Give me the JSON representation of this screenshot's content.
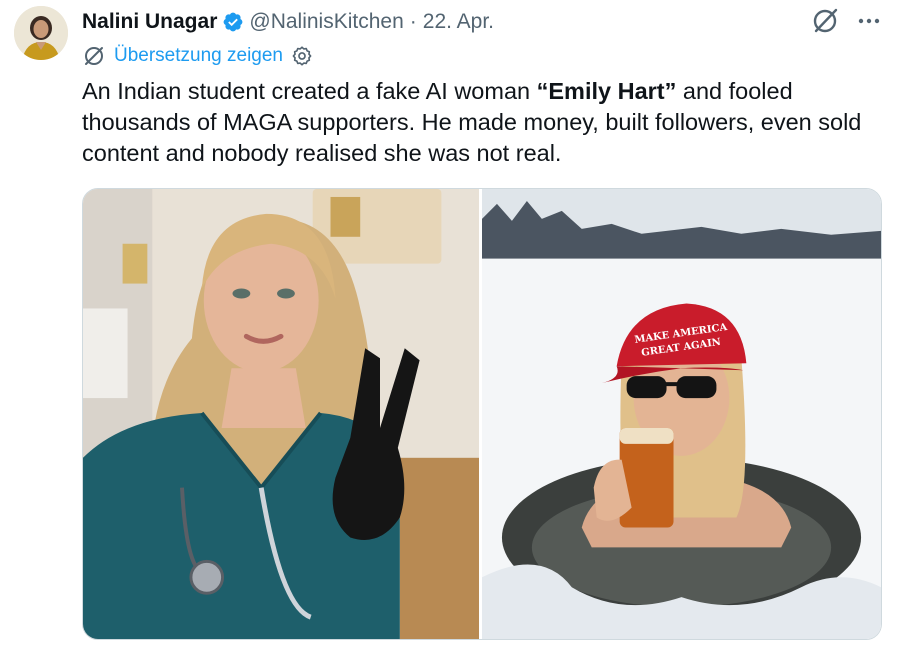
{
  "author": {
    "name": "Nalini Unagar",
    "handle": "@NalinisKitchen",
    "separator": "·",
    "date": "22. Apr."
  },
  "translate": {
    "label": "Übersetzung zeigen"
  },
  "tweet": {
    "text_part1": "An Indian student created a fake AI woman ",
    "quote_open": "“",
    "bold_name": "Emily Hart",
    "quote_close": "”",
    "text_part2": " and fooled thousands of MAGA supporters. He made money, built followers, even sold content and nobody realised she was not real."
  },
  "media": {
    "right_cap_text_line1": "MAKE AMERICA",
    "right_cap_text_line2": "GREAT AGAIN"
  },
  "icons": {
    "verified": "verified-badge-icon",
    "grok": "grok-icon",
    "more": "more-icon",
    "translate": "translate-icon",
    "settings": "settings-icon"
  },
  "colors": {
    "accent": "#1d9bf0",
    "text": "#0f1419",
    "secondary": "#536471"
  }
}
